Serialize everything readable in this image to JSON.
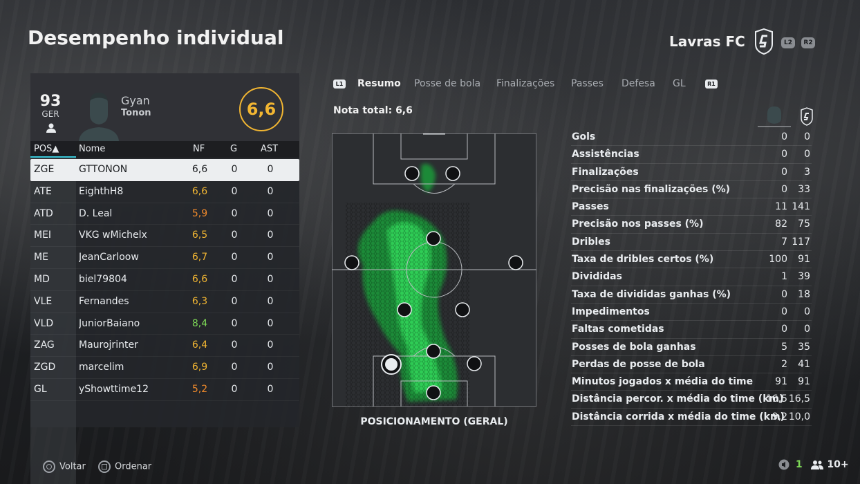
{
  "page_title": "Desempenho individual",
  "team": {
    "name": "Lavras FC",
    "prev_bumper": "L2",
    "next_bumper": "R2"
  },
  "player": {
    "overall": "93",
    "overall_label": "GER",
    "first_name": "Gyan",
    "last_name": "Tonon",
    "rating": "6,6"
  },
  "table": {
    "headers": {
      "pos": "POS▲",
      "name": "Nome",
      "nf": "NF",
      "g": "G",
      "ast": "AST"
    },
    "rows": [
      {
        "pos": "ZGE",
        "name": "GTTONON",
        "nf": "6,6",
        "g": "0",
        "ast": "0",
        "color": "#1b1d20"
      },
      {
        "pos": "ATE",
        "name": "EighthH8",
        "nf": "6,6",
        "g": "0",
        "ast": "0",
        "color": "#f2b632"
      },
      {
        "pos": "ATD",
        "name": "D. Leal",
        "nf": "5,9",
        "g": "0",
        "ast": "0",
        "color": "#f08a2b"
      },
      {
        "pos": "MEI",
        "name": "VKG wMichelx",
        "nf": "6,5",
        "g": "0",
        "ast": "0",
        "color": "#f2b632"
      },
      {
        "pos": "ME",
        "name": "JeanCarloow",
        "nf": "6,7",
        "g": "0",
        "ast": "0",
        "color": "#f2b632"
      },
      {
        "pos": "MD",
        "name": "biel79804",
        "nf": "6,6",
        "g": "0",
        "ast": "0",
        "color": "#f2b632"
      },
      {
        "pos": "VLE",
        "name": "Fernandes",
        "nf": "6,3",
        "g": "0",
        "ast": "0",
        "color": "#f2b632"
      },
      {
        "pos": "VLD",
        "name": "JuniorBaiano",
        "nf": "8,4",
        "g": "0",
        "ast": "0",
        "color": "#7ed957"
      },
      {
        "pos": "ZAG",
        "name": "Maurojrinter",
        "nf": "6,4",
        "g": "0",
        "ast": "0",
        "color": "#f2b632"
      },
      {
        "pos": "ZGD",
        "name": "marcelim",
        "nf": "6,9",
        "g": "0",
        "ast": "0",
        "color": "#f2b632"
      },
      {
        "pos": "GL",
        "name": "yShowttime12",
        "nf": "5,2",
        "g": "0",
        "ast": "0",
        "color": "#f08a2b"
      }
    ]
  },
  "tabs": {
    "left_bumper": "L1",
    "right_bumper": "R1",
    "items": [
      "Resumo",
      "Posse de bola",
      "Finalizações",
      "Passes",
      "Defesa",
      "GL"
    ],
    "active": 0
  },
  "total_rating": "Nota total: 6,6",
  "pitch_caption": "POSICIONAMENTO (GERAL)",
  "stats": [
    {
      "label": "Gols",
      "player": "0",
      "team": "0"
    },
    {
      "label": "Assistências",
      "player": "0",
      "team": "0"
    },
    {
      "label": "Finalizações",
      "player": "0",
      "team": "3"
    },
    {
      "label": "Precisão nas finalizações (%)",
      "player": "0",
      "team": "33"
    },
    {
      "label": "Passes",
      "player": "11",
      "team": "141"
    },
    {
      "label": "Precisão nos passes (%)",
      "player": "82",
      "team": "75"
    },
    {
      "label": "Dribles",
      "player": "7",
      "team": "117"
    },
    {
      "label": "Taxa de dribles certos (%)",
      "player": "100",
      "team": "91"
    },
    {
      "label": "Divididas",
      "player": "1",
      "team": "39"
    },
    {
      "label": "Taxa de divididas ganhas (%)",
      "player": "0",
      "team": "18"
    },
    {
      "label": "Impedimentos",
      "player": "0",
      "team": "0"
    },
    {
      "label": "Faltas cometidas",
      "player": "0",
      "team": "0"
    },
    {
      "label": "Posses de bola ganhas",
      "player": "5",
      "team": "35"
    },
    {
      "label": "Perdas de posse de bola",
      "player": "2",
      "team": "41"
    },
    {
      "label": "Minutos jogados x média do time",
      "player": "91",
      "team": "91"
    },
    {
      "label": "Distância percor. x média do time (km)",
      "player": "16,5",
      "team": "16,5"
    },
    {
      "label": "Distância corrida x média do time (km)",
      "player": "9,2",
      "team": "10,0"
    }
  ],
  "footer": {
    "back_label": "Voltar",
    "sort_label": "Ordenar",
    "count_a": "1",
    "count_b": "10+"
  },
  "colors": {
    "accent": "#37c5d6",
    "rating": "#f2b632",
    "heat": "#2ecc55"
  }
}
